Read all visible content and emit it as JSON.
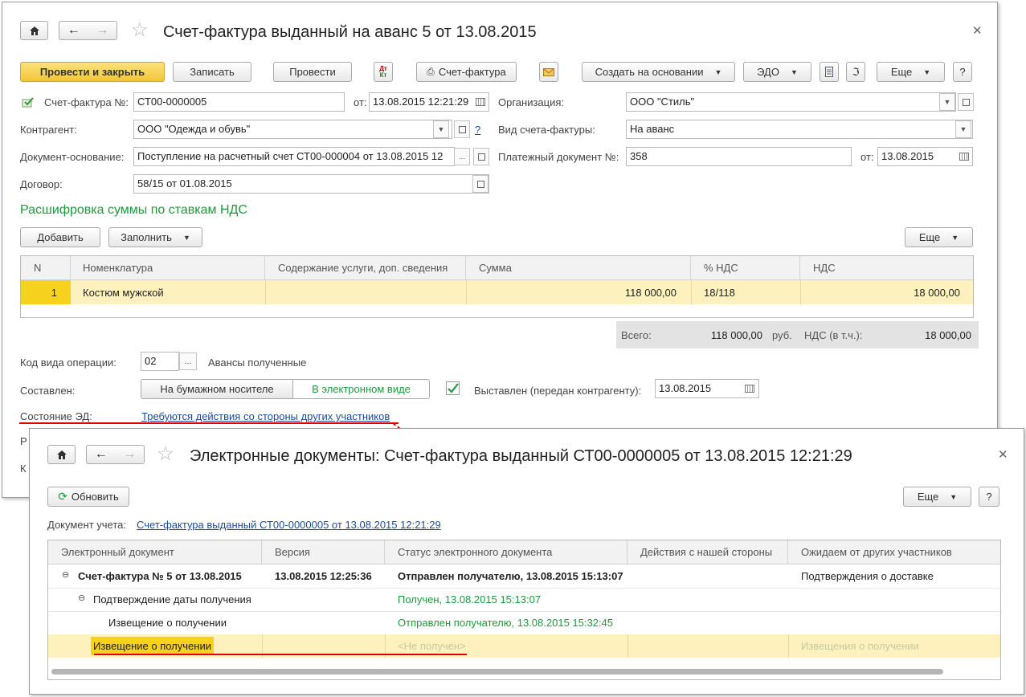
{
  "win1": {
    "title": "Счет-фактура выданный на аванс 5 от 13.08.2015",
    "toolbar": {
      "post_close": "Провести и закрыть",
      "save": "Записать",
      "post": "Провести",
      "dtkt_top": "Дт",
      "dtkt_bottom": "Кт",
      "invoice_print": "Счет-фактура",
      "create_based": "Создать на основании",
      "edo": "ЭДО",
      "more": "Еще",
      "help": "?"
    },
    "form": {
      "invoice_no_label": "Счет-фактура №:",
      "invoice_no": "СТ00-0000005",
      "from_label": "от:",
      "date": "13.08.2015 12:21:29",
      "org_label": "Организация:",
      "org": "ООО \"Стиль\"",
      "counterparty_label": "Контрагент:",
      "counterparty": "ООО \"Одежда и обувь\"",
      "question": "?",
      "invoice_type_label": "Вид счета-фактуры:",
      "invoice_type": "На аванс",
      "base_doc_label": "Документ-основание:",
      "base_doc": "Поступление на расчетный счет СТ00-000004 от 13.08.2015 12",
      "pay_doc_label": "Платежный документ №:",
      "pay_doc": "358",
      "pay_from_label": "от:",
      "pay_date": "13.08.2015",
      "contract_label": "Договор:",
      "contract": "58/15 от 01.08.2015"
    },
    "section_title": "Расшифровка суммы по ставкам НДС",
    "table_toolbar": {
      "add": "Добавить",
      "fill": "Заполнить",
      "more": "Еще"
    },
    "table": {
      "headers": [
        "N",
        "Номенклатура",
        "Содержание услуги, доп. сведения",
        "Сумма",
        "% НДС",
        "НДС"
      ],
      "row": {
        "n": "1",
        "item": "Костюм мужской",
        "content": "",
        "sum": "118 000,00",
        "rate": "18/118",
        "vat": "18 000,00"
      }
    },
    "totals": {
      "total_label": "Всего:",
      "total": "118 000,00",
      "currency": "руб.",
      "vat_label": "НДС (в т.ч.):",
      "vat": "18 000,00"
    },
    "opcode_label": "Код вида операции:",
    "opcode": "02",
    "opcode_dots": "...",
    "opcode_desc": "Авансы полученные",
    "composed_label": "Составлен:",
    "paper": "На бумажном носителе",
    "electronic": "В электронном виде",
    "issued_label": "Выставлен (передан контрагенту):",
    "issued_date": "13.08.2015",
    "ed_state_label": "Состояние ЭД:",
    "ed_state_link": "Требуются действия со стороны других участников",
    "cut_label_1": "Р",
    "cut_label_2": "К"
  },
  "win2": {
    "title": "Электронные документы: Счет-фактура выданный СТ00-0000005 от 13.08.2015 12:21:29",
    "refresh": "Обновить",
    "more": "Еще",
    "help": "?",
    "doc_label": "Документ учета:",
    "doc_link": "Счет-фактура выданный СТ00-0000005 от 13.08.2015 12:21:29",
    "headers": [
      "Электронный документ",
      "Версия",
      "Статус электронного документа",
      "Действия с нашей стороны",
      "Ожидаем от других участников"
    ],
    "rows": [
      {
        "doc": "Счет-фактура № 5 от 13.08.2015",
        "version": "13.08.2015 12:25:36",
        "status": "Отправлен получателю, 13.08.2015 15:13:07",
        "actions": "",
        "expect": "Подтверждения о доставке"
      },
      {
        "doc": "Подтверждение даты получения",
        "version": "",
        "status": "Получен, 13.08.2015 15:13:07",
        "actions": "",
        "expect": ""
      },
      {
        "doc": "Извещение о получении",
        "version": "",
        "status": "Отправлен получателю, 13.08.2015 15:32:45",
        "actions": "",
        "expect": ""
      },
      {
        "doc": "Извещение о получении",
        "version": "",
        "status": "<Не получен>",
        "actions": "",
        "expect": "Извещения о получении"
      }
    ]
  },
  "colors": {
    "accent_green": "#1c9a3c",
    "link_blue": "#1a4b9c",
    "annotation_red": "#e00000",
    "row_highlight": "#fdf2bd",
    "primary_button": "#f2c53a"
  },
  "icons": [
    "home-icon",
    "back-arrow-icon",
    "forward-arrow-icon",
    "star-icon",
    "close-icon",
    "printer-icon",
    "envelope-icon",
    "document-icon",
    "paperclip-icon",
    "calendar-icon",
    "open-link-icon",
    "checkmark-icon",
    "refresh-icon",
    "collapse-icon"
  ]
}
